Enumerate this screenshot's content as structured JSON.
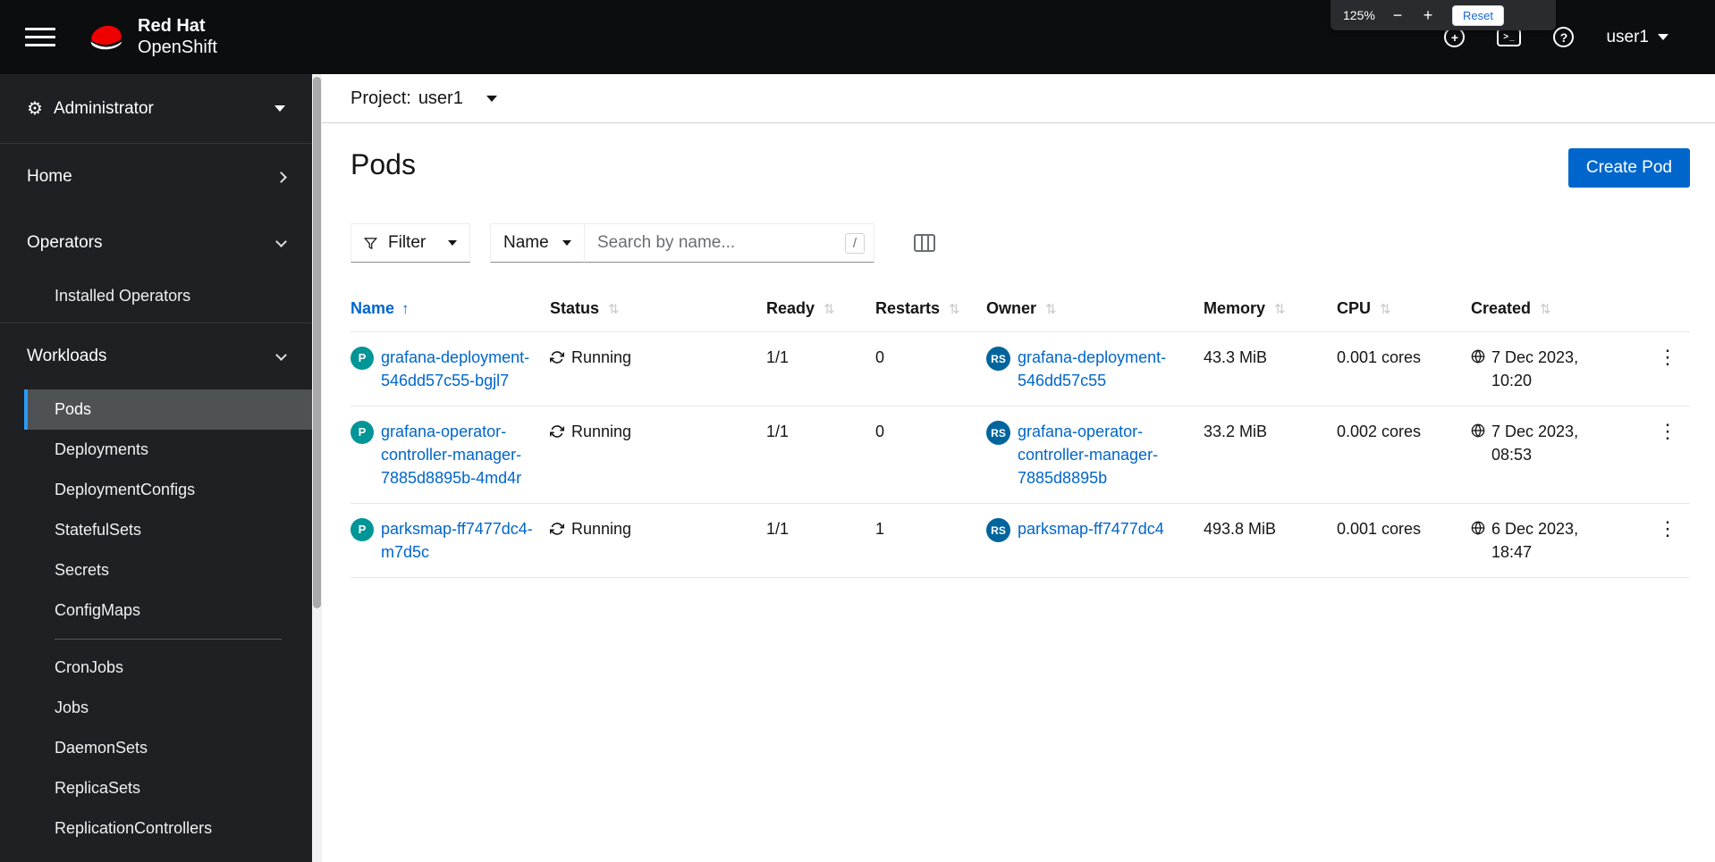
{
  "header": {
    "brand_line1": "Red Hat",
    "brand_line2": "OpenShift",
    "user_label": "user1"
  },
  "zoom_overlay": {
    "level": "125%",
    "minus": "−",
    "plus": "+",
    "reset_label": "Reset"
  },
  "sidebar": {
    "perspective_label": "Administrator",
    "home_label": "Home",
    "operators_label": "Operators",
    "operators_items": [
      {
        "label": "Installed Operators"
      }
    ],
    "workloads_label": "Workloads",
    "workloads_items": [
      {
        "label": "Pods",
        "selected": true
      },
      {
        "label": "Deployments"
      },
      {
        "label": "DeploymentConfigs"
      },
      {
        "label": "StatefulSets"
      },
      {
        "label": "Secrets"
      },
      {
        "label": "ConfigMaps"
      },
      {
        "label": "CronJobs"
      },
      {
        "label": "Jobs"
      },
      {
        "label": "DaemonSets"
      },
      {
        "label": "ReplicaSets"
      },
      {
        "label": "ReplicationControllers"
      }
    ]
  },
  "project_bar": {
    "label": "Project:",
    "value": "user1"
  },
  "page": {
    "title": "Pods",
    "create_button_label": "Create Pod"
  },
  "toolbar": {
    "filter_label": "Filter",
    "attribute_label": "Name",
    "search_placeholder": "Search by name...",
    "search_shortcut": "/"
  },
  "table": {
    "columns": [
      "Name",
      "Status",
      "Ready",
      "Restarts",
      "Owner",
      "Memory",
      "CPU",
      "Created"
    ],
    "sorted_by": "Name",
    "sort_direction": "ascending",
    "rows": [
      {
        "badge": "P",
        "name": "grafana-deployment-546dd57c55-bgjl7",
        "status": "Running",
        "ready": "1/1",
        "restarts": "0",
        "owner_badge": "RS",
        "owner": "grafana-deployment-546dd57c55",
        "memory": "43.3 MiB",
        "cpu": "0.001 cores",
        "created": "7 Dec 2023, 10:20"
      },
      {
        "badge": "P",
        "name": "grafana-operator-controller-manager-7885d8895b-4md4r",
        "status": "Running",
        "ready": "1/1",
        "restarts": "0",
        "owner_badge": "RS",
        "owner": "grafana-operator-controller-manager-7885d8895b",
        "memory": "33.2 MiB",
        "cpu": "0.002 cores",
        "created": "7 Dec 2023, 08:53"
      },
      {
        "badge": "P",
        "name": "parksmap-ff7477dc4-m7d5c",
        "status": "Running",
        "ready": "1/1",
        "restarts": "1",
        "owner_badge": "RS",
        "owner": "parksmap-ff7477dc4",
        "memory": "493.8 MiB",
        "cpu": "0.001 cores",
        "created": "6 Dec 2023, 18:47"
      }
    ]
  },
  "icons": {
    "gear": "⚙",
    "plus": "+",
    "terminal_glyph": ">_",
    "question": "?",
    "sort": "⇅",
    "sort_asc": "↑",
    "kebab": "⋮"
  },
  "colors": {
    "accent": "#0066cc",
    "link": "#0066cc",
    "brand_red": "#ee0000",
    "pod_badge": "#009596",
    "replicaset_badge": "#00659c",
    "nav_selected_border": "#2b9af3",
    "masthead_bg": "#0c0d0f",
    "sidebar_bg": "#1f2023"
  }
}
